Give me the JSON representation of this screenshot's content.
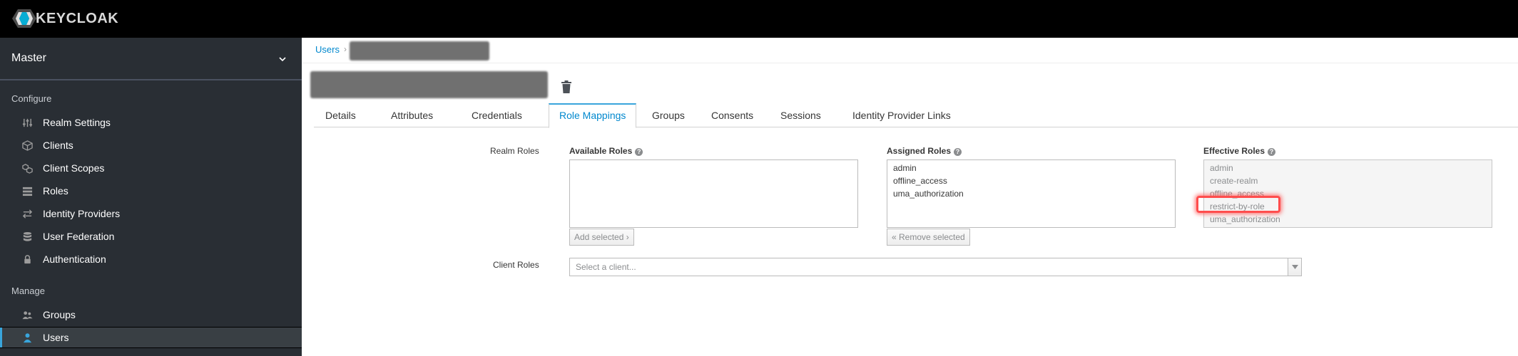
{
  "header": {
    "brand": "KEYCLOAK"
  },
  "sidebar": {
    "realm": "Master",
    "sections": [
      {
        "label": "Configure",
        "items": [
          {
            "label": "Realm Settings",
            "icon": "sliders-icon"
          },
          {
            "label": "Clients",
            "icon": "cube-icon"
          },
          {
            "label": "Client Scopes",
            "icon": "scopes-icon"
          },
          {
            "label": "Roles",
            "icon": "list-icon"
          },
          {
            "label": "Identity Providers",
            "icon": "exchange-icon"
          },
          {
            "label": "User Federation",
            "icon": "database-icon"
          },
          {
            "label": "Authentication",
            "icon": "lock-icon"
          }
        ]
      },
      {
        "label": "Manage",
        "items": [
          {
            "label": "Groups",
            "icon": "users-icon"
          },
          {
            "label": "Users",
            "icon": "user-icon",
            "active": true
          }
        ]
      }
    ]
  },
  "breadcrumb": {
    "root": "Users",
    "separator": "›"
  },
  "tabs": [
    "Details",
    "Attributes",
    "Credentials",
    "Role Mappings",
    "Groups",
    "Consents",
    "Sessions",
    "Identity Provider Links"
  ],
  "active_tab": "Role Mappings",
  "role_mappings": {
    "realm_roles_label": "Realm Roles",
    "available": {
      "label": "Available Roles",
      "items": [],
      "button": "Add selected ›"
    },
    "assigned": {
      "label": "Assigned Roles",
      "items": [
        "admin",
        "offline_access",
        "uma_authorization"
      ],
      "button": "« Remove selected"
    },
    "effective": {
      "label": "Effective Roles",
      "items": [
        "admin",
        "create-realm",
        "offline_access",
        "restrict-by-role",
        "uma_authorization"
      ],
      "highlighted": "restrict-by-role"
    },
    "client_roles_label": "Client Roles",
    "client_select_placeholder": "Select a client..."
  },
  "colors": {
    "accent": "#0088ce",
    "sidebar": "#292e34",
    "highlight": "#ff4d4d"
  }
}
